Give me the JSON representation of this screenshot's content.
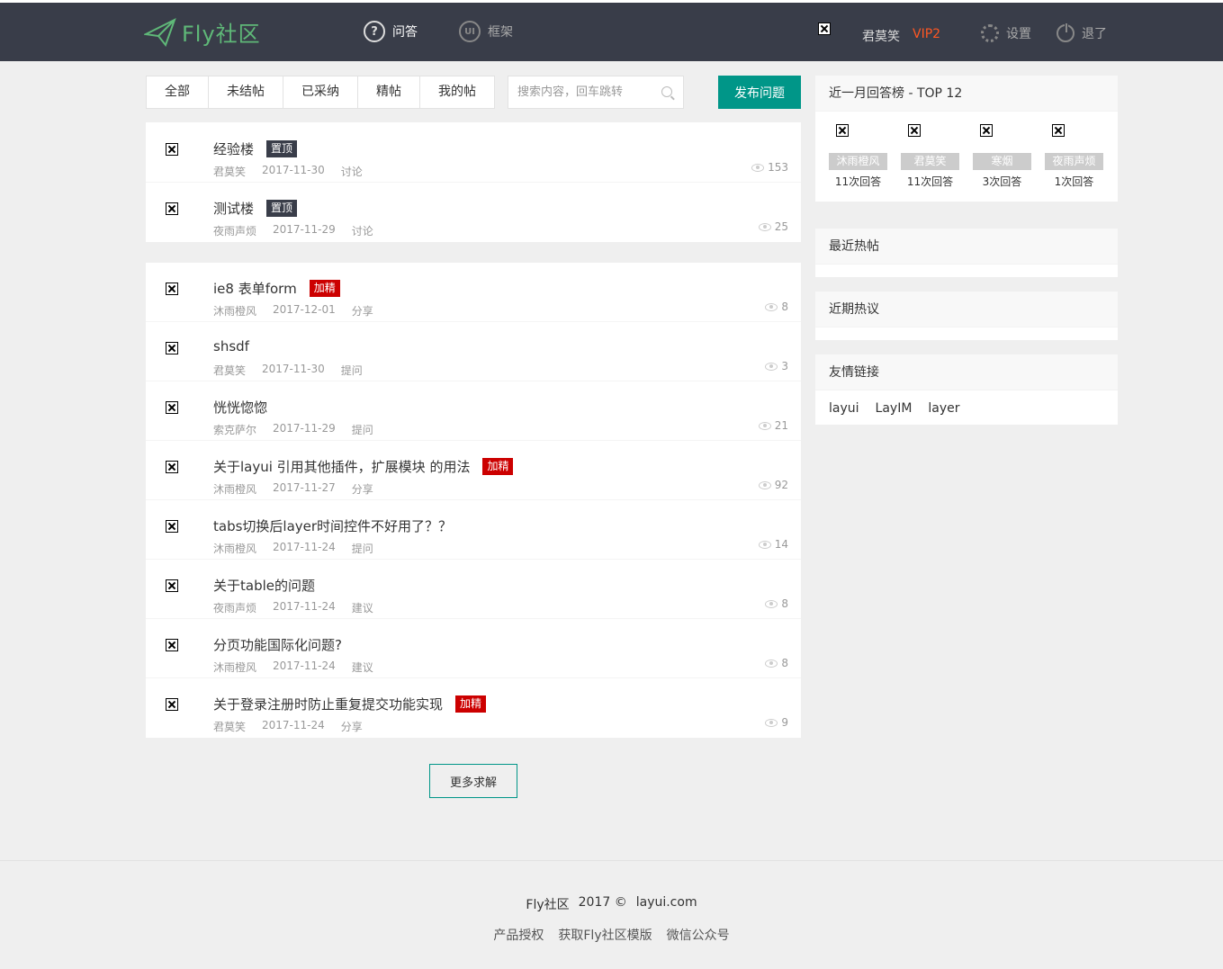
{
  "header": {
    "logo_text": "Fly社区",
    "nav": [
      {
        "label": "问答",
        "icon": "question-icon"
      },
      {
        "label": "框架",
        "icon": "ui-icon"
      }
    ],
    "user_name": "君莫笑",
    "vip": "VIP2",
    "settings_label": "设置",
    "logout_label": "退了"
  },
  "filters": [
    "全部",
    "未结帖",
    "已采纳",
    "精帖",
    "我的帖"
  ],
  "search": {
    "placeholder": "搜索内容，回车跳转"
  },
  "publish_label": "发布问题",
  "pinned": [
    {
      "title": "经验楼",
      "badge": "置顶",
      "badge_type": "top",
      "author": "君莫笑",
      "date": "2017-11-30",
      "category": "讨论",
      "views": "153"
    },
    {
      "title": "测试楼",
      "badge": "置顶",
      "badge_type": "top",
      "author": "夜雨声烦",
      "date": "2017-11-29",
      "category": "讨论",
      "views": "25"
    }
  ],
  "posts": [
    {
      "title": "ie8 表单form",
      "badge": "加精",
      "badge_type": "fine",
      "author": "沐雨橙风",
      "date": "2017-12-01",
      "category": "分享",
      "views": "8"
    },
    {
      "title": "shsdf",
      "badge": "",
      "badge_type": "",
      "author": "君莫笑",
      "date": "2017-11-30",
      "category": "提问",
      "views": "3"
    },
    {
      "title": "恍恍惚惚",
      "badge": "",
      "badge_type": "",
      "author": "索克萨尔",
      "date": "2017-11-29",
      "category": "提问",
      "views": "21"
    },
    {
      "title": "关于layui 引用其他插件，扩展模块 的用法",
      "badge": "加精",
      "badge_type": "fine",
      "author": "沐雨橙风",
      "date": "2017-11-27",
      "category": "分享",
      "views": "92"
    },
    {
      "title": "tabs切换后layer时间控件不好用了？？",
      "badge": "",
      "badge_type": "",
      "author": "沐雨橙风",
      "date": "2017-11-24",
      "category": "提问",
      "views": "14"
    },
    {
      "title": "关于table的问题",
      "badge": "",
      "badge_type": "",
      "author": "夜雨声烦",
      "date": "2017-11-24",
      "category": "建议",
      "views": "8"
    },
    {
      "title": "分页功能国际化问题?",
      "badge": "",
      "badge_type": "",
      "author": "沐雨橙风",
      "date": "2017-11-24",
      "category": "建议",
      "views": "8"
    },
    {
      "title": "关于登录注册时防止重复提交功能实现",
      "badge": "加精",
      "badge_type": "fine",
      "author": "君莫笑",
      "date": "2017-11-24",
      "category": "分享",
      "views": "9"
    }
  ],
  "more_label": "更多求解",
  "sidebar": {
    "top_title": "近一月回答榜 - TOP 12",
    "top_users": [
      {
        "name": "沐雨橙风",
        "count": "11次回答"
      },
      {
        "name": "君莫笑",
        "count": "11次回答"
      },
      {
        "name": "寒烟",
        "count": "3次回答"
      },
      {
        "name": "夜雨声烦",
        "count": "1次回答"
      }
    ],
    "hot_title": "最近热帖",
    "discuss_title": "近期热议",
    "links_title": "友情链接",
    "links": [
      "layui",
      "LayIM",
      "layer"
    ]
  },
  "footer": {
    "brand": "Fly社区",
    "year": "2017 ©",
    "site": "layui.com",
    "links": [
      "产品授权",
      "获取Fly社区模版",
      "微信公众号"
    ]
  }
}
